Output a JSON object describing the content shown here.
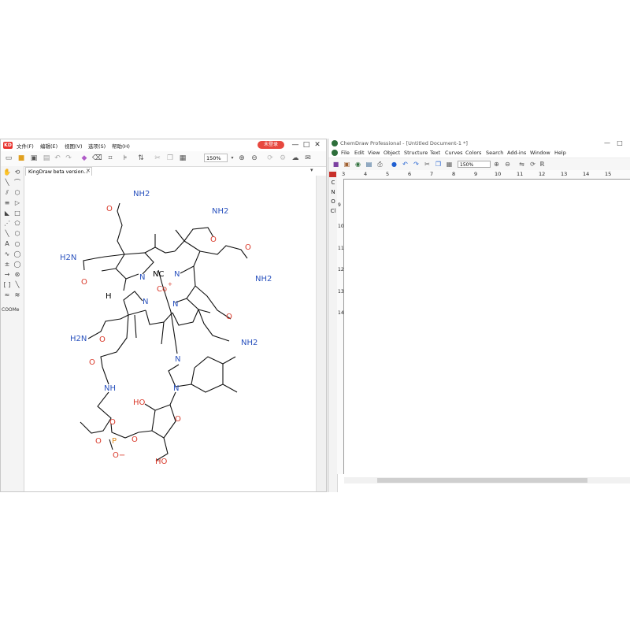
{
  "kingdraw": {
    "logo": "KD",
    "menu": [
      "文件(F)",
      "编辑(E)",
      "视图(V)",
      "选项(S)",
      "帮助(H)"
    ],
    "login_button": "未登录",
    "controls": {
      "minimize": "—",
      "maximize": "□",
      "close": "✕"
    },
    "zoom": "150%",
    "tab_title": "KingDraw beta version...",
    "tab_close": "✕",
    "tab_menu": "▾",
    "left_tool_labels": {
      "coome": "COOMe"
    },
    "molecule": {
      "nh2": "NH2",
      "h2n": "H2N",
      "o": "O",
      "n": "N",
      "nc": "NC",
      "co": "Co",
      "plus": "+",
      "h": "H",
      "nh": "NH",
      "ho": "HO",
      "oh": "OH",
      "p": "P",
      "ominus": "O−"
    }
  },
  "chemdraw": {
    "title": "ChemDraw Professional - [Untitled Document-1 *]",
    "controls": {
      "minimize": "—",
      "maximize": "□"
    },
    "menu": [
      "File",
      "Edit",
      "View",
      "Object",
      "Structure",
      "Text",
      "Curves",
      "Colors",
      "Search",
      "Add-ins",
      "Window",
      "Help"
    ],
    "zoom": "150%",
    "left_tools": [
      "C",
      "N",
      "O",
      "Cl"
    ],
    "ruler_h": [
      "3",
      "4",
      "5",
      "6",
      "7",
      "8",
      "9",
      "10",
      "11",
      "12",
      "13",
      "14",
      "15"
    ],
    "ruler_v": [
      "9",
      "10",
      "11",
      "12",
      "13",
      "14"
    ]
  }
}
